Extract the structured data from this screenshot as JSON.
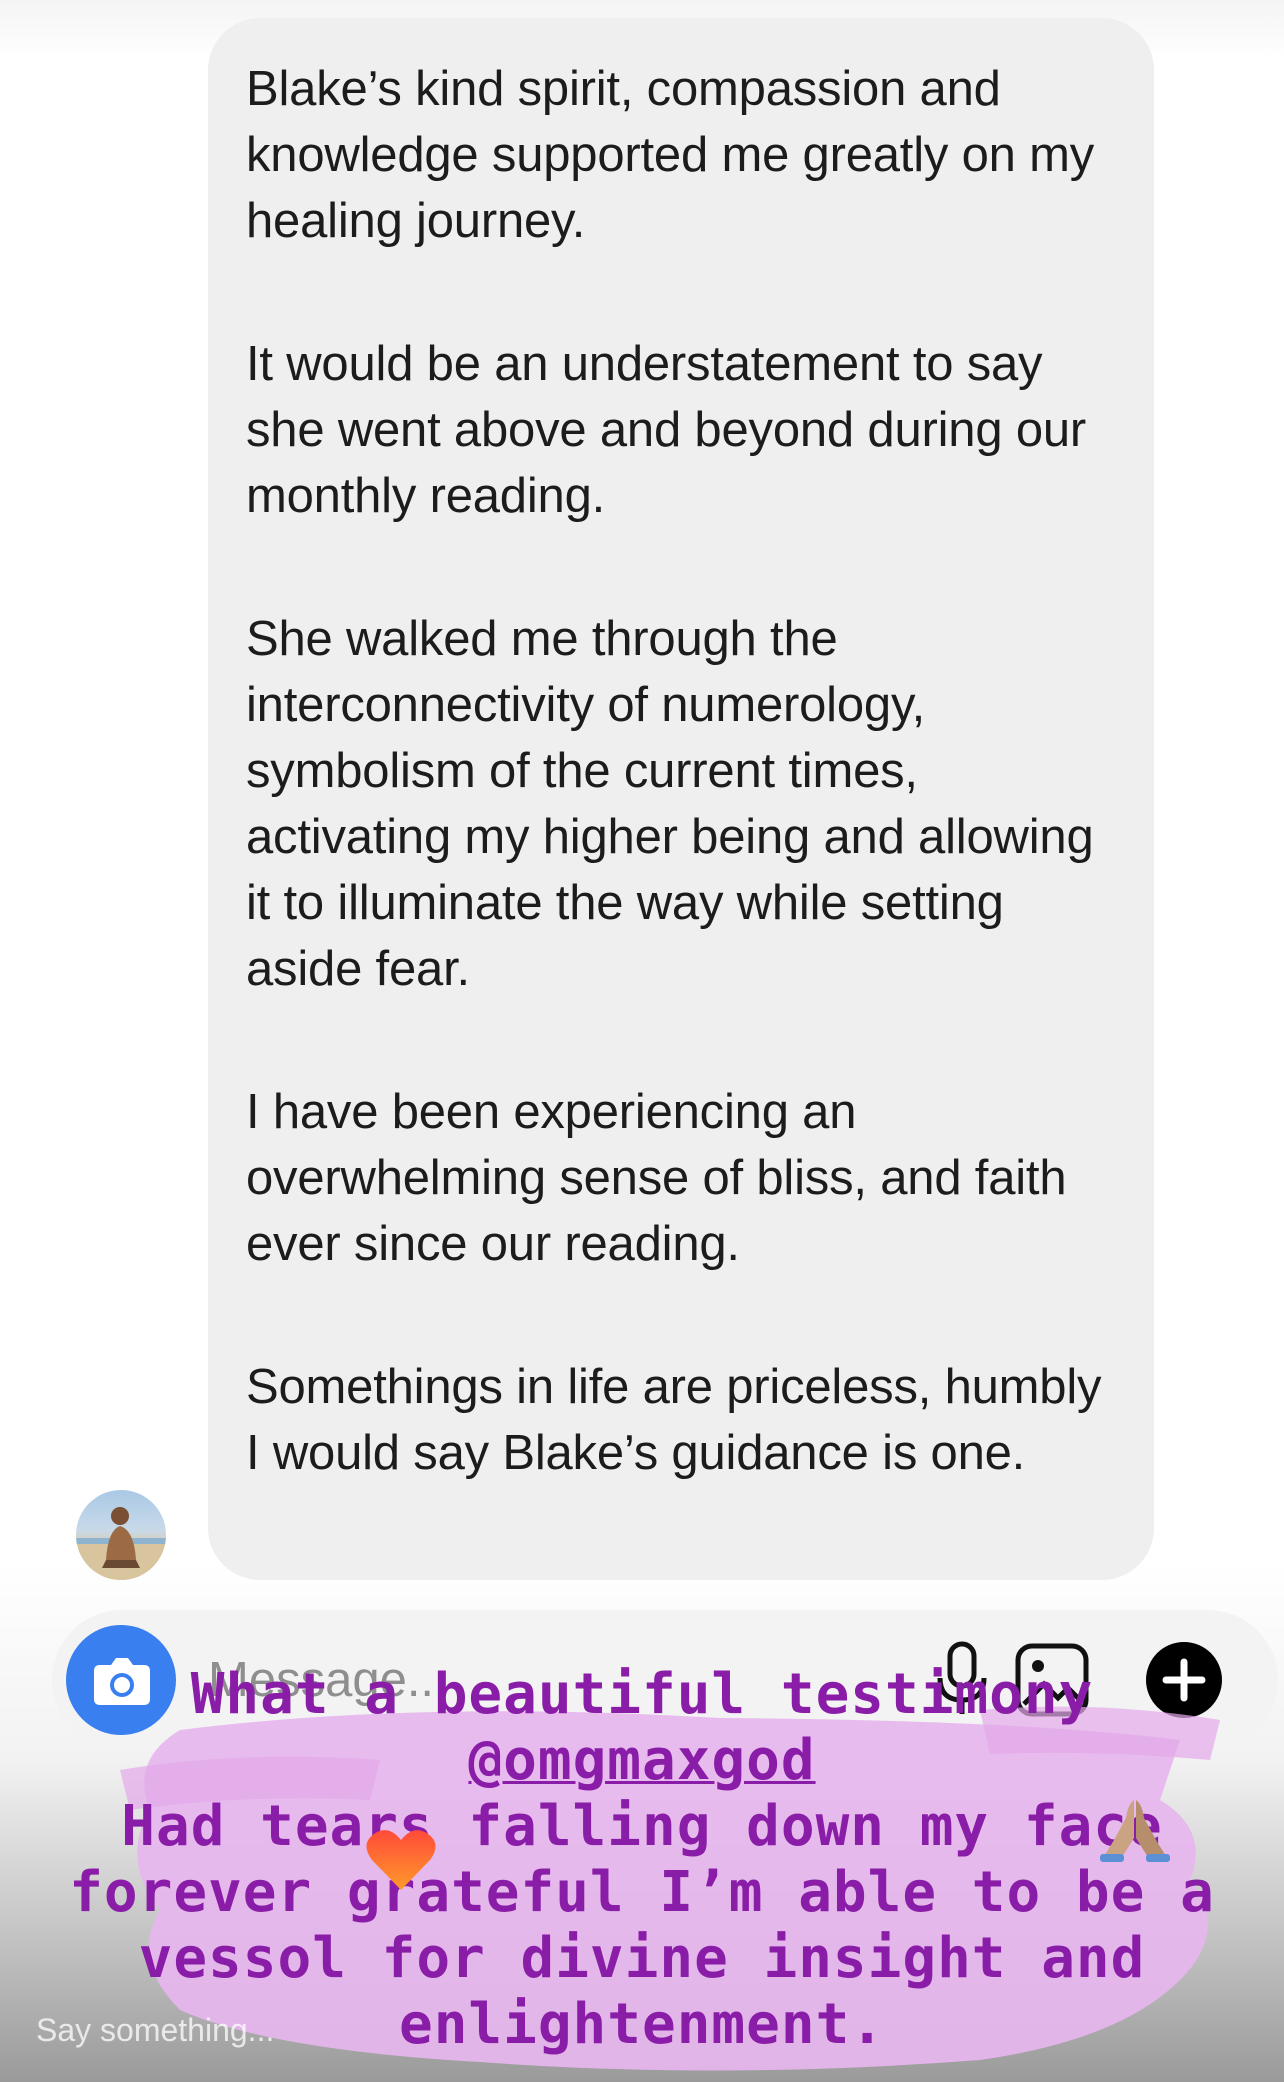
{
  "message_thread": {
    "incoming_message": {
      "paragraphs": [
        "Blake’s kind spirit, compassion and knowledge supported me greatly on my healing journey.",
        "It would be an understatement to say she went above and beyond during our monthly reading.",
        "She walked me through the interconnectivity of numerology, symbolism of the current times, activating my higher being and allowing it to illuminate the way while setting aside fear.",
        "I have been experiencing an overwhelming sense of bliss, and faith ever since our reading.",
        "Somethings in life are priceless, humbly I would say Blake’s guidance is one."
      ]
    }
  },
  "composer": {
    "placeholder": "Message...",
    "icons": [
      "camera-icon",
      "microphone-icon",
      "gallery-icon",
      "plus-icon"
    ],
    "accent_color": "#3a7ff0"
  },
  "story_overlay": {
    "lines": {
      "line1": "What a beautiful testimony",
      "mention": "@omgmaxgod",
      "line3": "Had tears falling down my face",
      "line4": "forever grateful I’m able to be a",
      "line5": "vessol for divine insight and",
      "line6": "enlightenment."
    },
    "stickers": [
      "heart-emoji",
      "praying-hands-emoji"
    ],
    "text_color": "#8a1da8",
    "brush_color": "#e7b6ee"
  },
  "story_reply": {
    "placeholder": "Say something..."
  }
}
